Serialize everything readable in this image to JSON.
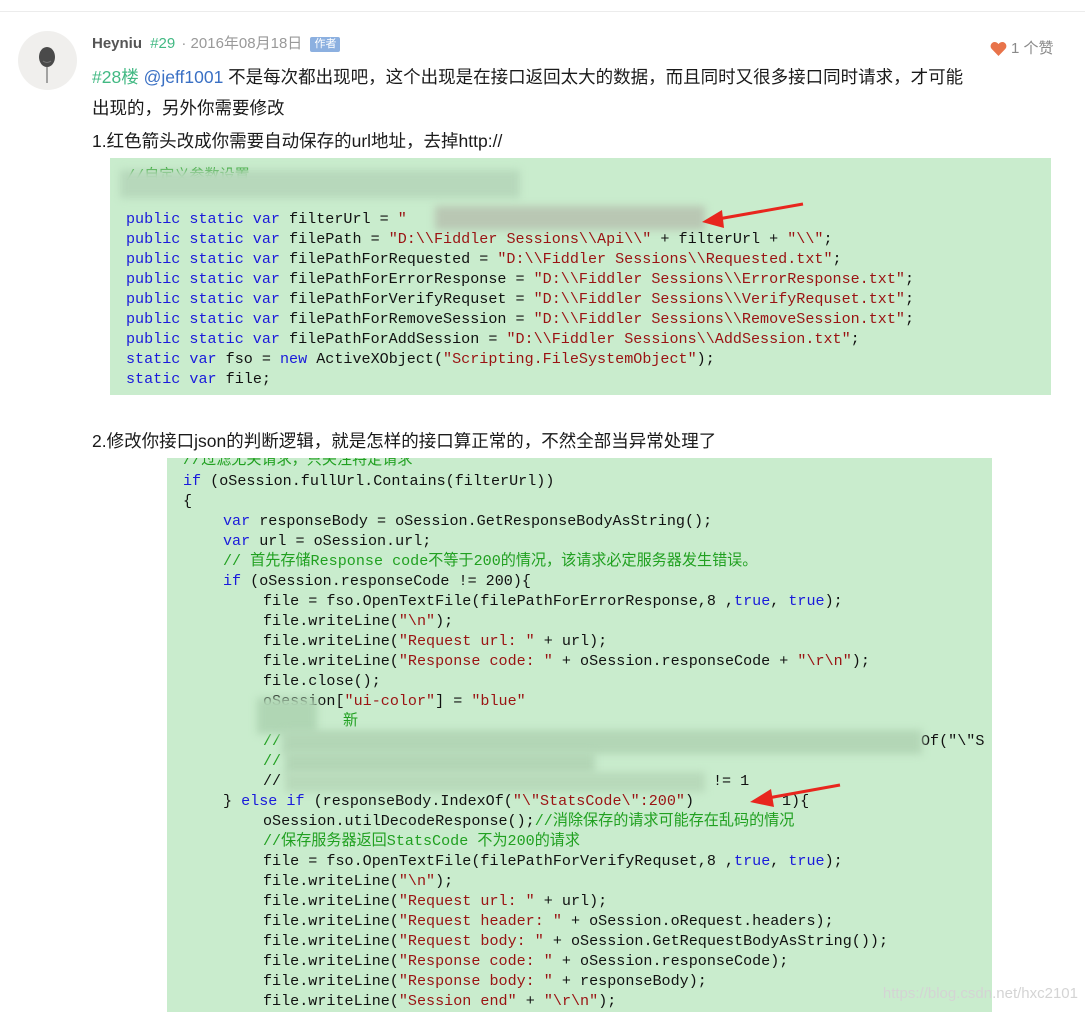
{
  "comment": {
    "author": "Heyniu",
    "floor_tag": "#29",
    "date": "· 2016年08月18日",
    "role_badge": "作者",
    "likes": "1 个赞",
    "reply_floor": "#28楼",
    "mention": "@jeff1001",
    "line1_rest": " 不是每次都出现吧，这个出现是在接口返回太大的数据，而且同时又很多接口同时请求，才可能",
    "line2": "出现的，另外你需要修改",
    "step1": "1.红色箭头改成你需要自动保存的url地址，去掉http://",
    "step2": "2.修改你接口json的判断逻辑，就是怎样的接口算正常的，不然全部当异常处理了"
  },
  "code_block_1": {
    "comment_line": "//自定义参数设置",
    "lines": [
      {
        "kw": "public static var ",
        "rest": "filterUrl = ",
        "str": "\""
      },
      {
        "kw": "public static var ",
        "rest": "filePath = ",
        "str": "\"D:\\\\Fiddler Sessions\\\\Api\\\\\"",
        "tail": " + filterUrl + ",
        "str2": "\"\\\\\"",
        "end": ";"
      },
      {
        "kw": "public static var ",
        "rest": "filePathForRequested = ",
        "str": "\"D:\\\\Fiddler Sessions\\\\Requested.txt\"",
        "end": ";"
      },
      {
        "kw": "public static var ",
        "rest": "filePathForErrorResponse = ",
        "str": "\"D:\\\\Fiddler Sessions\\\\ErrorResponse.txt\"",
        "end": ";"
      },
      {
        "kw": "public static var ",
        "rest": "filePathForVerifyRequset = ",
        "str": "\"D:\\\\Fiddler Sessions\\\\VerifyRequset.txt\"",
        "end": ";"
      },
      {
        "kw": "public static var ",
        "rest": "filePathForRemoveSession = ",
        "str": "\"D:\\\\Fiddler Sessions\\\\RemoveSession.txt\"",
        "end": ";"
      },
      {
        "kw": "public static var ",
        "rest": "filePathForAddSession = ",
        "str": "\"D:\\\\Fiddler Sessions\\\\AddSession.txt\"",
        "end": ";"
      },
      {
        "kw": "static var ",
        "rest": "fso = ",
        "kw2": "new ",
        "rest2": "ActiveXObject(",
        "str": "\"Scripting.FileSystemObject\"",
        "end": ");"
      },
      {
        "kw": "static var ",
        "rest": "file;"
      }
    ]
  },
  "code_block_2": {
    "l01": "//过滤无关请求，只关注特定请求",
    "l02_kw": "if",
    "l02_rest": " (oSession.fullUrl.Contains(filterUrl))",
    "l03": "{",
    "l04_kw": "var",
    "l04_rest": " responseBody = oSession.GetResponseBodyAsString();",
    "l05_kw": "var",
    "l05_rest": " url = oSession.url;",
    "l06": "// 首先存储Response code不等于200的情况，该请求必定服务器发生错误。",
    "l07_kw": "if",
    "l07_rest": " (oSession.responseCode != 200){",
    "l08_a": "file = fso.OpenTextFile(filePathForErrorResponse,8 ,",
    "l08_kw1": "true",
    "l08_b": ", ",
    "l08_kw2": "true",
    "l08_c": ");",
    "l09_a": "file.writeLine(",
    "l09_str": "\"\\n\"",
    "l09_b": ");",
    "l10_a": "file.writeLine(",
    "l10_str": "\"Request url: \"",
    "l10_b": " + url);",
    "l11_a": "file.writeLine(",
    "l11_str": "\"Response code: \"",
    "l11_b": " + oSession.responseCode + ",
    "l11_str2": "\"\\r\\n\"",
    "l11_c": ");",
    "l12": "file.close();",
    "l13_a": "oSession[",
    "l13_str": "\"ui-color\"",
    "l13_b": "] = ",
    "l13_str2": "\"blue\"",
    "l14": "新",
    "l15_a": "//",
    "l15_b": "Of(\"\\\"S",
    "l16": "//",
    "l17_a": "//",
    "l17_b": "!= 1",
    "l18_a": "} ",
    "l18_kw": "else if",
    "l18_b": " (responseBody.IndexOf(",
    "l18_str": "\"\\\"StatsCode\\\":200\"",
    "l18_c": ")",
    "l18_d": "1){",
    "l19_a": "oSession.utilDecodeResponse();",
    "l19_cm": "//消除保存的请求可能存在乱码的情况",
    "l20": "//保存服务器返回StatsCode 不为200的请求",
    "l21_a": "file = fso.OpenTextFile(filePathForVerifyRequset,8 ,",
    "l21_kw1": "true",
    "l21_b": ", ",
    "l21_kw2": "true",
    "l21_c": ");",
    "l22_a": "file.writeLine(",
    "l22_str": "\"\\n\"",
    "l22_b": ");",
    "l23_a": "file.writeLine(",
    "l23_str": "\"Request url: \"",
    "l23_b": " + url);",
    "l24_a": "file.writeLine(",
    "l24_str": "\"Request header: \"",
    "l24_b": " + oSession.oRequest.headers);",
    "l25_a": "file.writeLine(",
    "l25_str": "\"Request body: \"",
    "l25_b": " + oSession.GetRequestBodyAsString());",
    "l26_a": "file.writeLine(",
    "l26_str": "\"Response code: \"",
    "l26_b": " + oSession.responseCode);",
    "l27_a": "file.writeLine(",
    "l27_str": "\"Response body: \"",
    "l27_b": " + responseBody);",
    "l28_a": "file.writeLine(",
    "l28_str": "\"Session end\"",
    "l28_b": " + ",
    "l28_str2": "\"\\r\\n\"",
    "l28_c": ");"
  },
  "watermark": "https://blog.csdn.net/hxc2101",
  "colors": {
    "floor_green": "#42b983",
    "mention_blue": "#3a70c4",
    "code_bg": "#c9eccd",
    "heart": "#e8734a",
    "arrow": "#e8261e"
  },
  "icons": {
    "heart": "heart-icon",
    "avatar": "balloon-avatar"
  }
}
